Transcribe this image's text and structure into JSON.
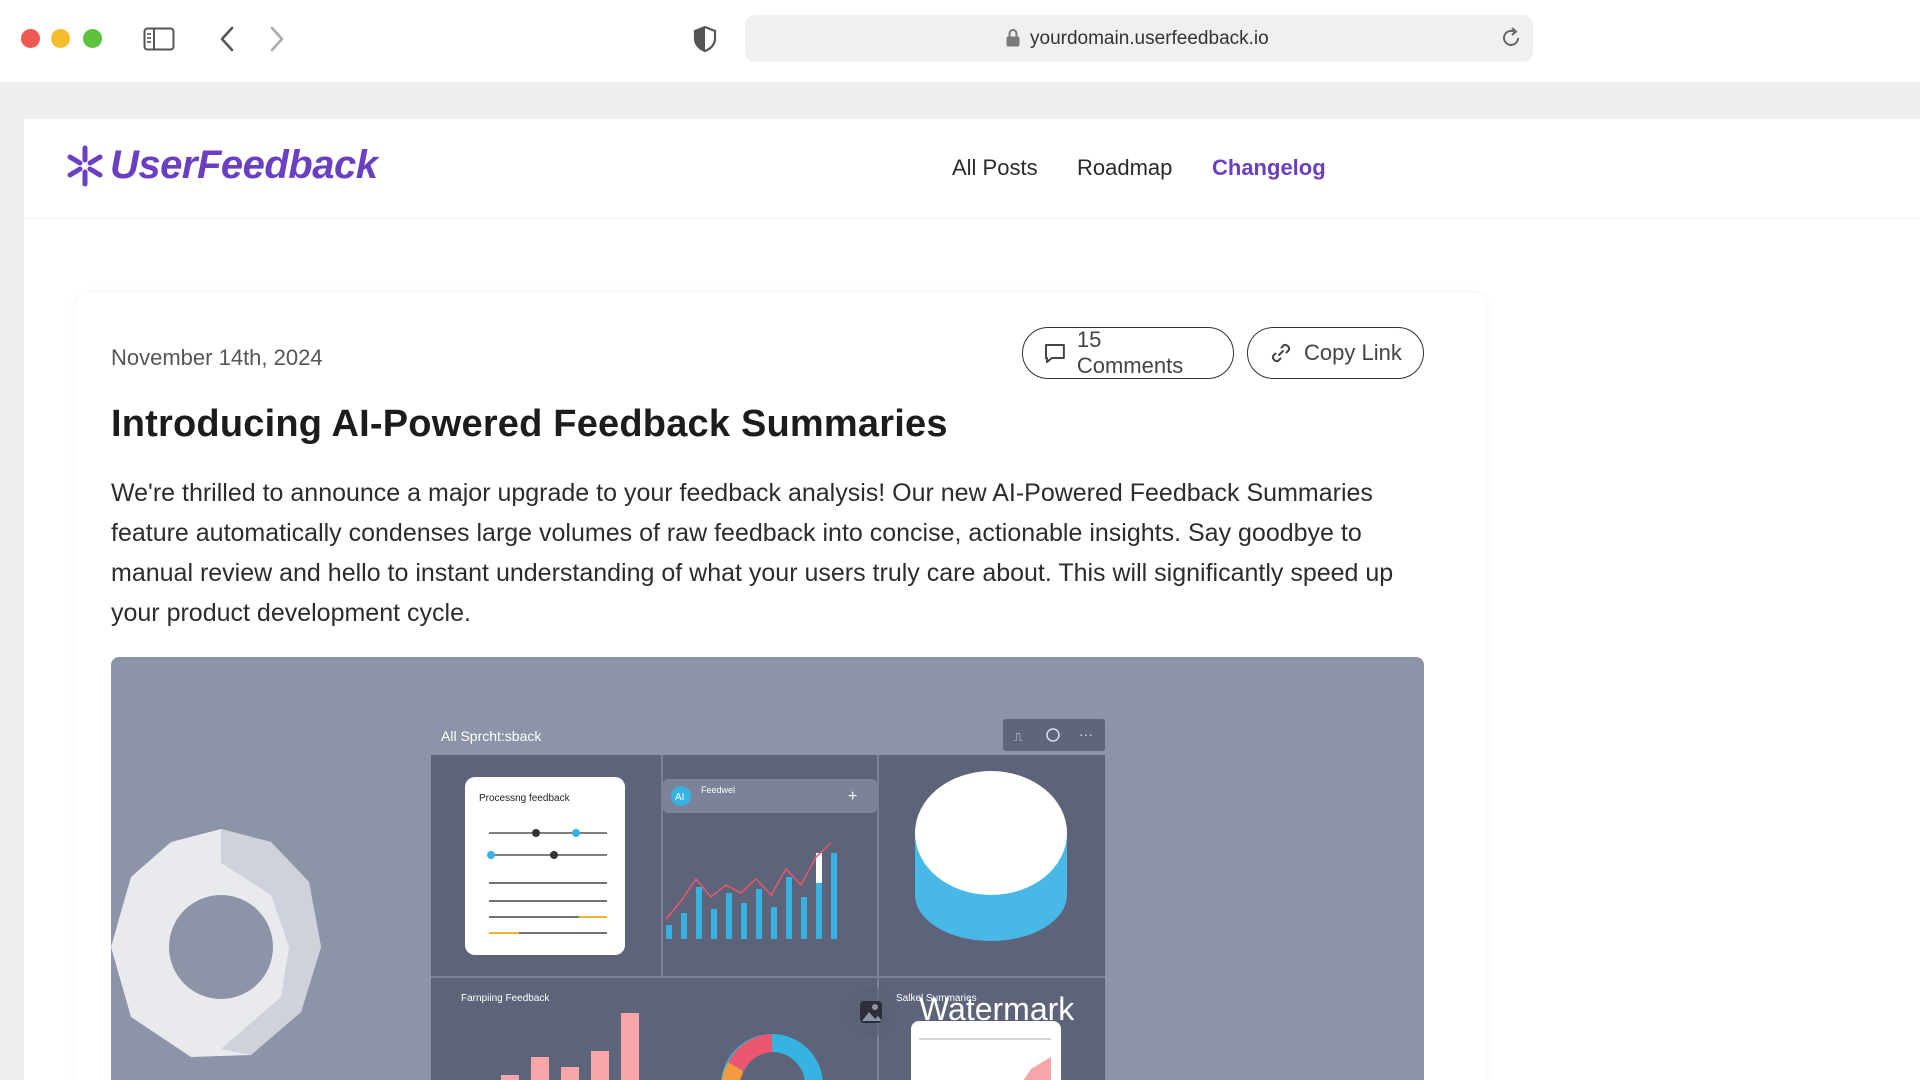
{
  "browser": {
    "url": "yourdomain.userfeedback.io",
    "icons": [
      "close-window",
      "minimize-window",
      "zoom-window",
      "sidebar-icon",
      "back-icon",
      "forward-icon",
      "shield-icon",
      "lock-icon",
      "reload-icon"
    ]
  },
  "site": {
    "logo_text": "UserFeedback",
    "brand_color": "#6a3fc1",
    "nav": {
      "all_posts": "All Posts",
      "roadmap": "Roadmap",
      "changelog": "Changelog"
    }
  },
  "post": {
    "date": "November 14th, 2024",
    "comments_label": "15 Comments",
    "copy_link_label": "Copy Link",
    "title": "Introducing AI-Powered Feedback Summaries",
    "body": "We're thrilled to announce a major upgrade to your feedback analysis! Our new AI-Powered Feedback Summaries feature automatically condenses large volumes of raw feedback into concise, actionable insights. Say goodbye to manual review and hello to instant understanding of what your users truly care about. This will significantly speed up your product development cycle."
  },
  "hero": {
    "window_title": "All Sprcht:sback",
    "panel_processing": "Processng feedback",
    "panel_ai_badge": "AI",
    "panel_feedback": "Feedwel",
    "panel_ranking": "Farnpiing Feedback",
    "panel_summary": "Salkel Summaries",
    "watermark": "Watermark"
  }
}
